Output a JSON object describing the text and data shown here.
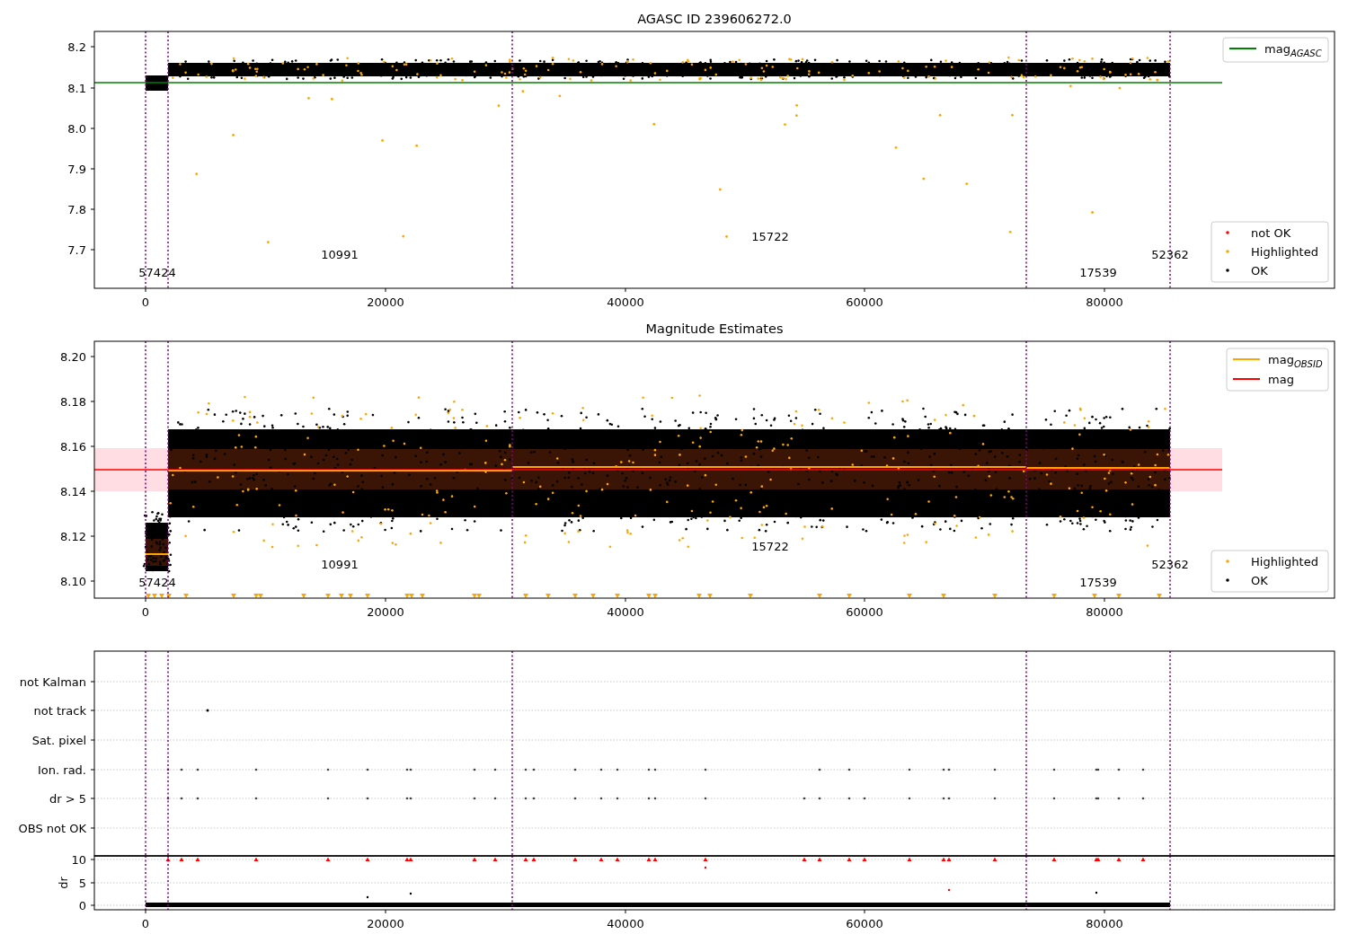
{
  "panels": [
    {
      "kind": "agasc",
      "title": "AGASC ID 239606272.0",
      "yticks": [
        "8.2",
        "8.1",
        "8.0",
        "7.9",
        "7.8",
        "7.7"
      ],
      "xticks": [
        "0",
        "20000",
        "40000",
        "60000",
        "80000"
      ],
      "legends": [
        [
          {
            "label": "mag",
            "subscript": "AGASC",
            "color": "#008000",
            "kind": "line"
          }
        ],
        [
          {
            "label": "not OK",
            "color": "#ff0000",
            "kind": "dot"
          },
          {
            "label": "Highlighted",
            "color": "#ffa500",
            "kind": "dot"
          },
          {
            "label": "OK",
            "color": "#000000",
            "kind": "dot"
          }
        ]
      ],
      "annotations": [
        "57424",
        "10991",
        "15722",
        "17539",
        "52362"
      ]
    },
    {
      "kind": "estimates",
      "title": "Magnitude Estimates",
      "yticks": [
        "8.20",
        "8.18",
        "8.16",
        "8.14",
        "8.12",
        "8.10"
      ],
      "xticks": [
        "0",
        "20000",
        "40000",
        "60000",
        "80000"
      ],
      "legends": [
        [
          {
            "label": "mag",
            "subscript": "OBSID",
            "color": "#ffa500",
            "kind": "line"
          },
          {
            "label": "mag",
            "color": "#ff0000",
            "kind": "line"
          }
        ],
        [
          {
            "label": "Highlighted",
            "color": "#ffa500",
            "kind": "dot"
          },
          {
            "label": "OK",
            "color": "#000000",
            "kind": "dot"
          }
        ]
      ],
      "annotations": [
        "57424",
        "10991",
        "15722",
        "17539",
        "52362"
      ]
    },
    {
      "kind": "flags",
      "yticks": [
        "not Kalman",
        "not track",
        "Sat. pixel",
        "Ion. rad.",
        "dr > 5",
        "OBS not OK"
      ]
    },
    {
      "kind": "dr",
      "ylabel": "dr",
      "yticks": [
        "10",
        "5",
        "0"
      ],
      "xticks": [
        "0",
        "20000",
        "40000",
        "60000",
        "80000"
      ]
    }
  ]
}
